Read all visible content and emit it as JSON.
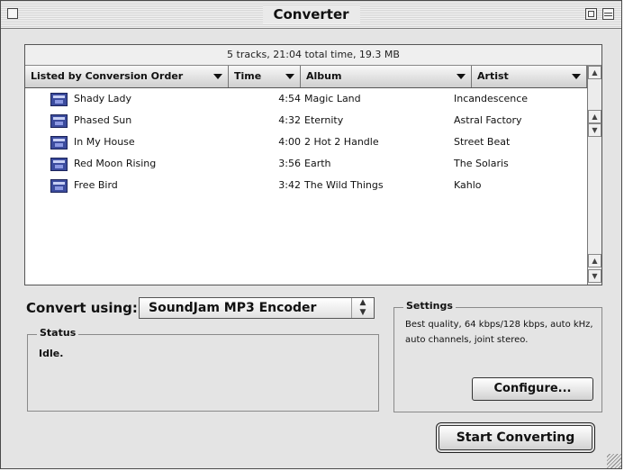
{
  "window": {
    "title": "Converter"
  },
  "track_list": {
    "summary": "5 tracks, 21:04 total time, 19.3 MB",
    "columns": [
      "Listed by Conversion Order",
      "Time",
      "Album",
      "Artist"
    ],
    "tracks": [
      {
        "name": "Shady Lady",
        "time": "4:54",
        "album": "Magic Land",
        "artist": "Incandescence"
      },
      {
        "name": "Phased Sun",
        "time": "4:32",
        "album": "Eternity",
        "artist": "Astral Factory"
      },
      {
        "name": "In My House",
        "time": "4:00",
        "album": "2 Hot 2 Handle",
        "artist": "Street Beat"
      },
      {
        "name": "Red Moon Rising",
        "time": "3:56",
        "album": "Earth",
        "artist": "The Solaris"
      },
      {
        "name": "Free Bird",
        "time": "3:42",
        "album": "The Wild Things",
        "artist": "Kahlo"
      }
    ],
    "track_icon": "mp3-file-icon"
  },
  "convert": {
    "label": "Convert using:",
    "encoder": "SoundJam MP3 Encoder"
  },
  "status": {
    "title": "Status",
    "text": "Idle."
  },
  "settings": {
    "title": "Settings",
    "text": "Best quality, 64 kbps/128 kbps, auto kHz, auto channels, joint stereo."
  },
  "buttons": {
    "configure": "Configure...",
    "start": "Start Converting"
  }
}
